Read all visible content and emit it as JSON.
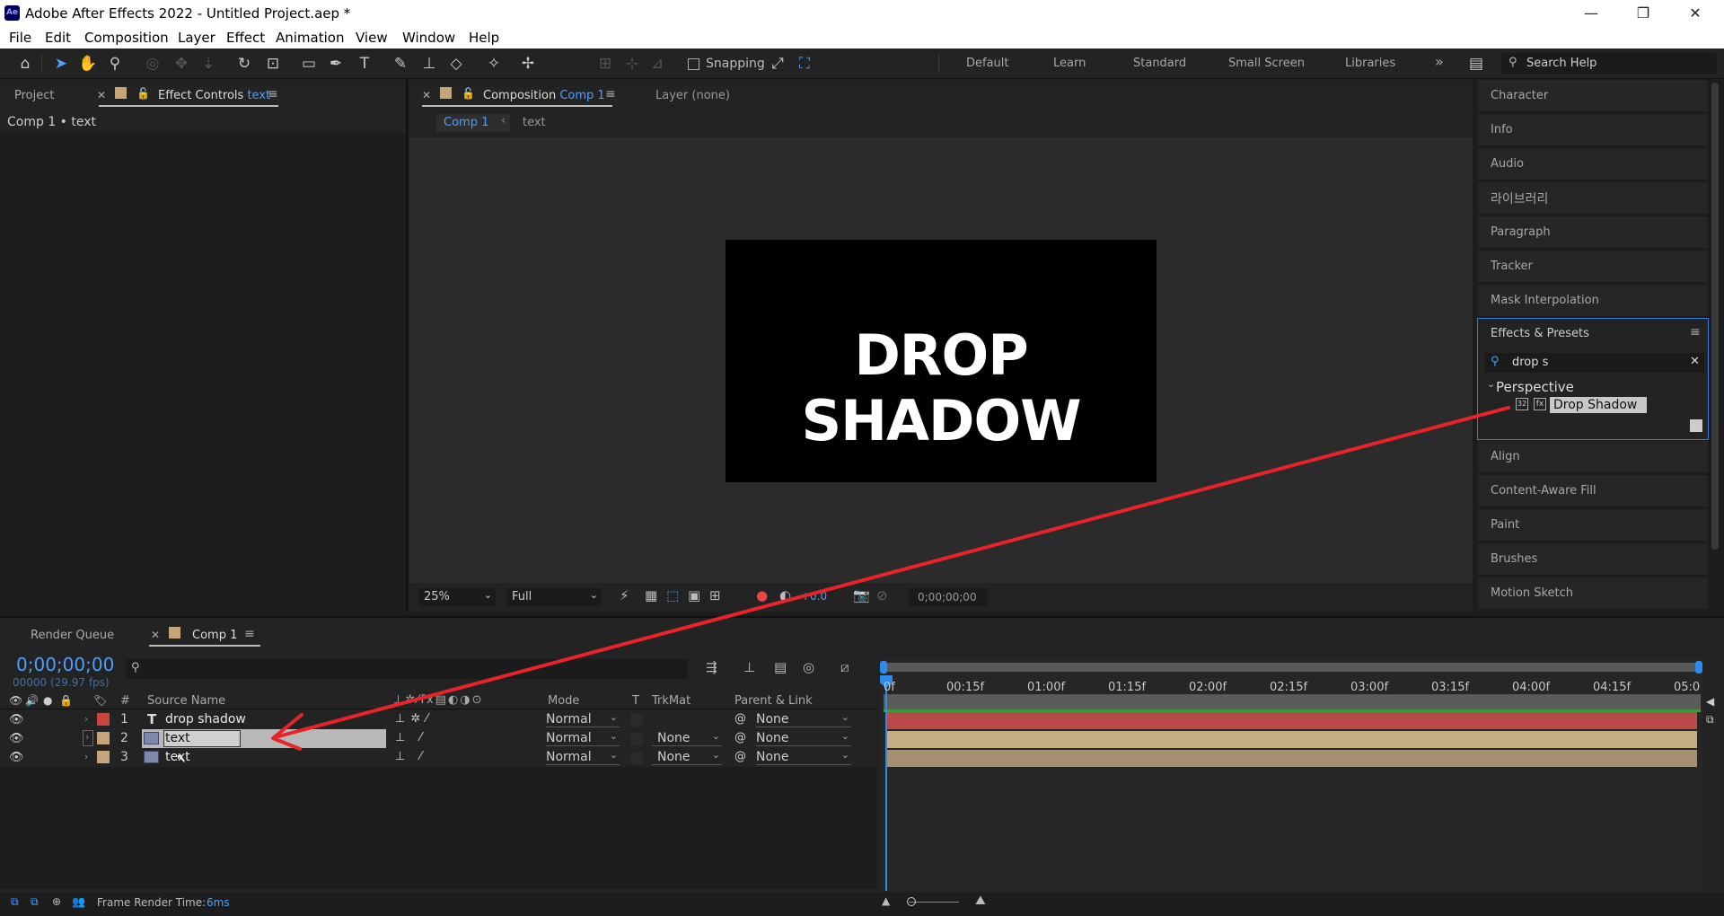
{
  "window": {
    "title": "Adobe After Effects 2022 - Untitled Project.aep *",
    "logo": "Ae",
    "min": "—",
    "restore": "❐",
    "close": "✕"
  },
  "menu": [
    "File",
    "Edit",
    "Composition",
    "Layer",
    "Effect",
    "Animation",
    "View",
    "Window",
    "Help"
  ],
  "toolbar": {
    "snapping_label": "Snapping",
    "workspaces": [
      "Default",
      "Learn",
      "Standard",
      "Small Screen",
      "Libraries"
    ],
    "more": "»",
    "search_placeholder": "Search Help"
  },
  "left_panel": {
    "tab_project": "Project",
    "tab_effect_controls": "Effect Controls",
    "tab_effect_controls_target": "text",
    "breadcrumb": "Comp 1 • text"
  },
  "comp_panel": {
    "tab_label": "Composition",
    "tab_target": "Comp 1",
    "layer_tab": "Layer (none)",
    "nav": [
      "Comp 1",
      "text"
    ],
    "canvas_text": "DROP SHADOW",
    "zoom": "25%",
    "resolution": "Full",
    "exposure": "+0.0",
    "timecode": "0;00;00;00"
  },
  "right_panel": {
    "items_top": [
      "Character",
      "Info",
      "Audio",
      "라이브러리",
      "Paragraph",
      "Tracker",
      "Mask Interpolation"
    ],
    "effects_title": "Effects & Presets",
    "search_value": "drop s",
    "category": "Perspective",
    "effect": "Drop Shadow",
    "badge": "32",
    "items_bottom": [
      "Align",
      "Content-Aware Fill",
      "Paint",
      "Brushes",
      "Motion Sketch"
    ]
  },
  "timeline": {
    "tab_render": "Render Queue",
    "tab_comp": "Comp 1",
    "timecode": "0;00;00;00",
    "frame_info": "00000 (29.97 fps)",
    "columns": {
      "num": "#",
      "source": "Source Name",
      "mode": "Mode",
      "t": "T",
      "trkmat": "TrkMat",
      "parent": "Parent & Link"
    },
    "layers": [
      {
        "num": "1",
        "name": "drop shadow",
        "mode": "Normal",
        "trkmat": "",
        "parent": "None",
        "color": "#c8463c",
        "type": "T"
      },
      {
        "num": "2",
        "name": "text",
        "mode": "Normal",
        "trkmat": "None",
        "parent": "None",
        "color": "#c4a67a",
        "type": "img"
      },
      {
        "num": "3",
        "name": "text",
        "mode": "Normal",
        "trkmat": "None",
        "parent": "None",
        "color": "#c4a67a",
        "type": "img"
      }
    ],
    "ruler": [
      "0f",
      "00:15f",
      "01:00f",
      "01:15f",
      "02:00f",
      "02:15f",
      "03:00f",
      "03:15f",
      "04:00f",
      "04:15f",
      "05:0"
    ],
    "status_label": "Frame Render Time:",
    "status_value": "6ms"
  }
}
